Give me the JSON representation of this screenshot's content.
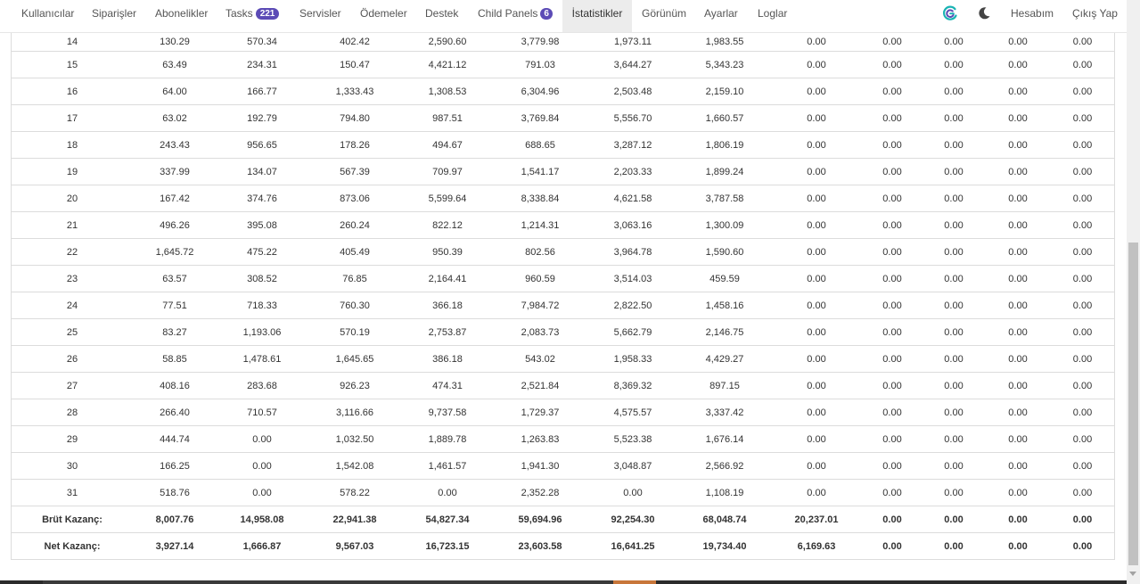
{
  "nav": {
    "items": [
      {
        "label": "Kullanıcılar"
      },
      {
        "label": "Siparişler"
      },
      {
        "label": "Abonelikler"
      },
      {
        "label": "Tasks",
        "badge": "221"
      },
      {
        "label": "Servisler"
      },
      {
        "label": "Ödemeler"
      },
      {
        "label": "Destek"
      },
      {
        "label": "Child Panels",
        "badge": "6"
      },
      {
        "label": "İstatistikler",
        "active": true
      },
      {
        "label": "Görünüm"
      },
      {
        "label": "Ayarlar"
      },
      {
        "label": "Loglar"
      }
    ],
    "account": "Hesabım",
    "logout": "Çıkış Yap",
    "brand_icon": "brand-logo-icon",
    "theme_icon": "moon-icon",
    "accent_color": "#5c4bb6"
  },
  "table": {
    "rows": [
      {
        "day": "14",
        "values": [
          "130.29",
          "570.34",
          "402.42",
          "2,590.60",
          "3,779.98",
          "1,973.11",
          "1,983.55",
          "0.00",
          "0.00",
          "0.00",
          "0.00",
          "0.00"
        ]
      },
      {
        "day": "15",
        "values": [
          "63.49",
          "234.31",
          "150.47",
          "4,421.12",
          "791.03",
          "3,644.27",
          "5,343.23",
          "0.00",
          "0.00",
          "0.00",
          "0.00",
          "0.00"
        ]
      },
      {
        "day": "16",
        "values": [
          "64.00",
          "166.77",
          "1,333.43",
          "1,308.53",
          "6,304.96",
          "2,503.48",
          "2,159.10",
          "0.00",
          "0.00",
          "0.00",
          "0.00",
          "0.00"
        ]
      },
      {
        "day": "17",
        "values": [
          "63.02",
          "192.79",
          "794.80",
          "987.51",
          "3,769.84",
          "5,556.70",
          "1,660.57",
          "0.00",
          "0.00",
          "0.00",
          "0.00",
          "0.00"
        ]
      },
      {
        "day": "18",
        "values": [
          "243.43",
          "956.65",
          "178.26",
          "494.67",
          "688.65",
          "3,287.12",
          "1,806.19",
          "0.00",
          "0.00",
          "0.00",
          "0.00",
          "0.00"
        ]
      },
      {
        "day": "19",
        "values": [
          "337.99",
          "134.07",
          "567.39",
          "709.97",
          "1,541.17",
          "2,203.33",
          "1,899.24",
          "0.00",
          "0.00",
          "0.00",
          "0.00",
          "0.00"
        ]
      },
      {
        "day": "20",
        "values": [
          "167.42",
          "374.76",
          "873.06",
          "5,599.64",
          "8,338.84",
          "4,621.58",
          "3,787.58",
          "0.00",
          "0.00",
          "0.00",
          "0.00",
          "0.00"
        ]
      },
      {
        "day": "21",
        "values": [
          "496.26",
          "395.08",
          "260.24",
          "822.12",
          "1,214.31",
          "3,063.16",
          "1,300.09",
          "0.00",
          "0.00",
          "0.00",
          "0.00",
          "0.00"
        ]
      },
      {
        "day": "22",
        "values": [
          "1,645.72",
          "475.22",
          "405.49",
          "950.39",
          "802.56",
          "3,964.78",
          "1,590.60",
          "0.00",
          "0.00",
          "0.00",
          "0.00",
          "0.00"
        ]
      },
      {
        "day": "23",
        "values": [
          "63.57",
          "308.52",
          "76.85",
          "2,164.41",
          "960.59",
          "3,514.03",
          "459.59",
          "0.00",
          "0.00",
          "0.00",
          "0.00",
          "0.00"
        ]
      },
      {
        "day": "24",
        "values": [
          "77.51",
          "718.33",
          "760.30",
          "366.18",
          "7,984.72",
          "2,822.50",
          "1,458.16",
          "0.00",
          "0.00",
          "0.00",
          "0.00",
          "0.00"
        ]
      },
      {
        "day": "25",
        "values": [
          "83.27",
          "1,193.06",
          "570.19",
          "2,753.87",
          "2,083.73",
          "5,662.79",
          "2,146.75",
          "0.00",
          "0.00",
          "0.00",
          "0.00",
          "0.00"
        ]
      },
      {
        "day": "26",
        "values": [
          "58.85",
          "1,478.61",
          "1,645.65",
          "386.18",
          "543.02",
          "1,958.33",
          "4,429.27",
          "0.00",
          "0.00",
          "0.00",
          "0.00",
          "0.00"
        ]
      },
      {
        "day": "27",
        "values": [
          "408.16",
          "283.68",
          "926.23",
          "474.31",
          "2,521.84",
          "8,369.32",
          "897.15",
          "0.00",
          "0.00",
          "0.00",
          "0.00",
          "0.00"
        ]
      },
      {
        "day": "28",
        "values": [
          "266.40",
          "710.57",
          "3,116.66",
          "9,737.58",
          "1,729.37",
          "4,575.57",
          "3,337.42",
          "0.00",
          "0.00",
          "0.00",
          "0.00",
          "0.00"
        ]
      },
      {
        "day": "29",
        "values": [
          "444.74",
          "0.00",
          "1,032.50",
          "1,889.78",
          "1,263.83",
          "5,523.38",
          "1,676.14",
          "0.00",
          "0.00",
          "0.00",
          "0.00",
          "0.00"
        ]
      },
      {
        "day": "30",
        "values": [
          "166.25",
          "0.00",
          "1,542.08",
          "1,461.57",
          "1,941.30",
          "3,048.87",
          "2,566.92",
          "0.00",
          "0.00",
          "0.00",
          "0.00",
          "0.00"
        ]
      },
      {
        "day": "31",
        "values": [
          "518.76",
          "0.00",
          "578.22",
          "0.00",
          "2,352.28",
          "0.00",
          "1,108.19",
          "0.00",
          "0.00",
          "0.00",
          "0.00",
          "0.00"
        ]
      }
    ],
    "totals": [
      {
        "label": "Brüt Kazanç:",
        "values": [
          "8,007.76",
          "14,958.08",
          "22,941.38",
          "54,827.34",
          "59,694.96",
          "92,254.30",
          "68,048.74",
          "20,237.01",
          "0.00",
          "0.00",
          "0.00",
          "0.00"
        ]
      },
      {
        "label": "Net Kazanç:",
        "values": [
          "3,927.14",
          "1,666.87",
          "9,567.03",
          "16,723.15",
          "23,603.58",
          "16,641.25",
          "19,734.40",
          "6,169.63",
          "0.00",
          "0.00",
          "0.00",
          "0.00"
        ]
      }
    ]
  }
}
